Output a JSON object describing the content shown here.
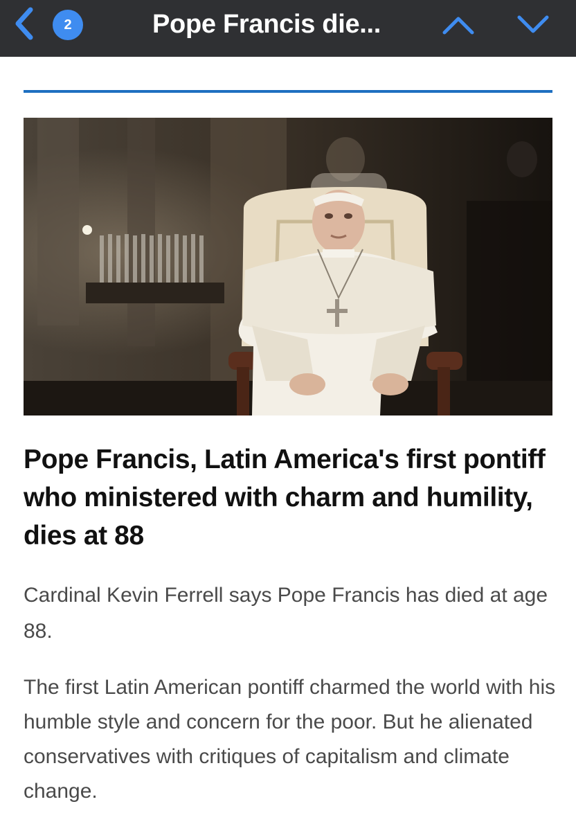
{
  "topbar": {
    "back_icon": "chevron-left-icon",
    "badge_count": "2",
    "title": "Pope Francis die...",
    "prev_icon": "chevron-up-icon",
    "next_icon": "chevron-down-icon",
    "background": "#2f3033",
    "accent": "#3f8cf0"
  },
  "article": {
    "rule_color": "#1e6fc0",
    "image": "photo of Pope Francis seated in a cream-colored chair, wearing white cassock and pectoral cross, in a dimly lit church",
    "headline": "Pope Francis, Latin America's first pontiff who ministered with charm and humility, dies at 88",
    "lede": "Cardinal Kevin Ferrell says Pope Francis has died at age 88.",
    "body": "The first Latin American pontiff charmed the world with his humble style and concern for the poor. But he alienated conservatives with critiques of capitalism and climate change."
  }
}
